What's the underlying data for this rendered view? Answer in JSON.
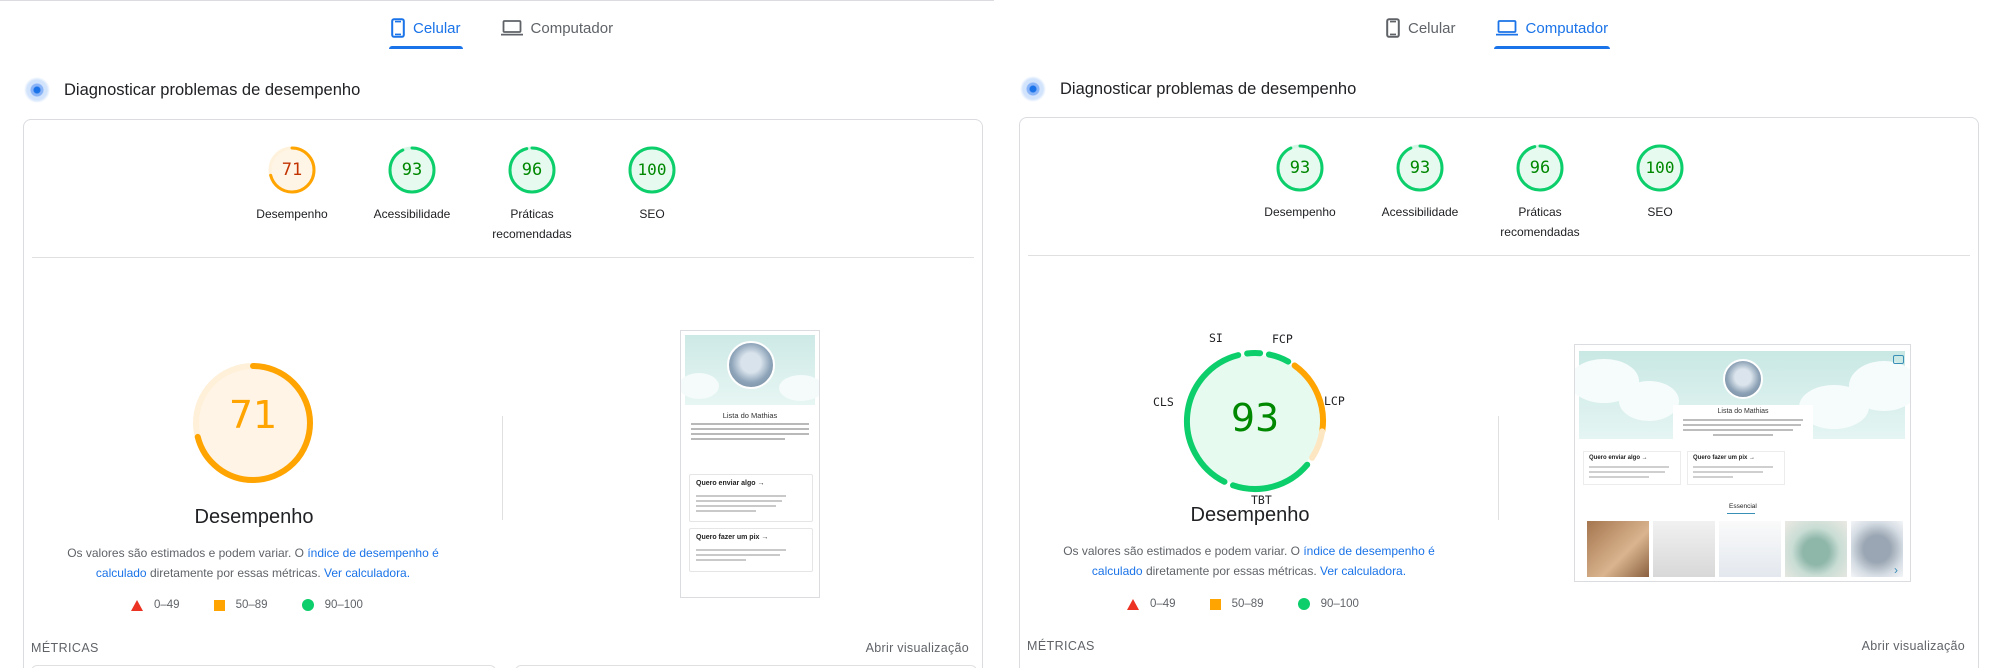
{
  "colors": {
    "accent": "#1a73e8",
    "pass": "#0cce6b",
    "pass_text": "#008800",
    "average": "#ffa400",
    "average_text": "#c33300",
    "fail": "#eb3223"
  },
  "mobile": {
    "tabs": [
      {
        "label": "Celular",
        "icon": "smartphone-icon",
        "active": true
      },
      {
        "label": "Computador",
        "icon": "laptop-icon",
        "active": false
      }
    ],
    "section_title": "Diagnosticar problemas de desempenho",
    "scores": [
      {
        "label": "Desempenho",
        "value": "71",
        "score": 71
      },
      {
        "label": "Acessibilidade",
        "value": "93",
        "score": 93
      },
      {
        "label": "Práticas recomendadas",
        "value": "96",
        "score": 96
      },
      {
        "label": "SEO",
        "value": "100",
        "score": 100
      }
    ],
    "big_score": {
      "value": "71",
      "score": 71,
      "title": "Desempenho"
    },
    "notes": {
      "prefix": "Os valores são estimados e podem variar. O ",
      "link1": "índice de desempenho é calculado",
      "middle": " diretamente por essas métricas. ",
      "link2": "Ver calculadora."
    },
    "legend": [
      {
        "shape": "triangle-red",
        "label": "0–49"
      },
      {
        "shape": "square-orange",
        "label": "50–89"
      },
      {
        "shape": "circle-green",
        "label": "90–100"
      }
    ],
    "metrics_label": "MÉTRICAS",
    "expand_label": "Abrir visualização",
    "screenshot": {
      "site_title": "Lista do Mathias",
      "card1": "Quero enviar algo →",
      "card2": "Quero fazer um pix →"
    }
  },
  "desktop": {
    "tabs": [
      {
        "label": "Celular",
        "icon": "smartphone-icon",
        "active": false
      },
      {
        "label": "Computador",
        "icon": "laptop-icon",
        "active": true
      }
    ],
    "section_title": "Diagnosticar problemas de desempenho",
    "scores": [
      {
        "label": "Desempenho",
        "value": "93",
        "score": 93
      },
      {
        "label": "Acessibilidade",
        "value": "93",
        "score": 93
      },
      {
        "label": "Práticas recomendadas",
        "value": "96",
        "score": 96
      },
      {
        "label": "SEO",
        "value": "100",
        "score": 100
      }
    ],
    "big_score": {
      "value": "93",
      "score": 93,
      "title": "Desempenho"
    },
    "metric_labels": {
      "si": "SI",
      "fcp": "FCP",
      "lcp": "LCP",
      "tbt": "TBT",
      "cls": "CLS"
    },
    "notes": {
      "prefix": "Os valores são estimados e podem variar. O ",
      "link1": "índice de desempenho é calculado",
      "middle": " diretamente por essas métricas. ",
      "link2": "Ver calculadora."
    },
    "legend": [
      {
        "shape": "triangle-red",
        "label": "0–49"
      },
      {
        "shape": "square-orange",
        "label": "50–89"
      },
      {
        "shape": "circle-green",
        "label": "90–100"
      }
    ],
    "metrics_label": "MÉTRICAS",
    "expand_label": "Abrir visualização",
    "screenshot": {
      "site_title": "Lista do Mathias",
      "card1": "Quero enviar algo →",
      "card2": "Quero fazer um pix →",
      "section": "Essencial"
    }
  }
}
